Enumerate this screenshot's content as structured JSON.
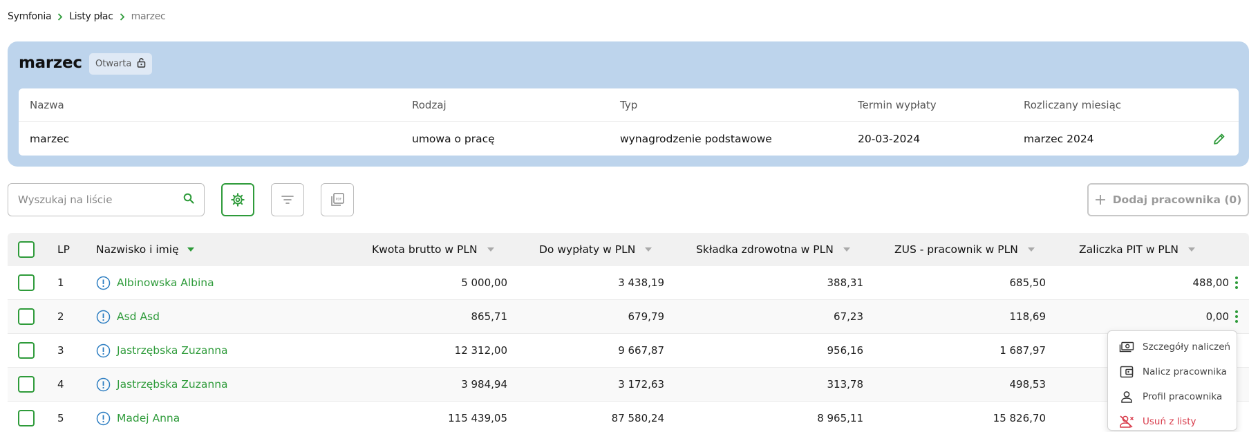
{
  "breadcrumb": [
    "Symfonia",
    "Listy płac",
    "marzec"
  ],
  "header": {
    "title": "marzec",
    "status": "Otwarta",
    "columns": [
      "Nazwa",
      "Rodzaj",
      "Typ",
      "Termin wypłaty",
      "Rozliczany miesiąc"
    ],
    "values": [
      "marzec",
      "umowa o pracę",
      "wynagrodzenie podstawowe",
      "20-03-2024",
      "marzec 2024"
    ]
  },
  "toolbar": {
    "search_placeholder": "Wyszukaj na liście",
    "add_label": "Dodaj pracownika (0)"
  },
  "table": {
    "columns": {
      "lp": "LP",
      "name": "Nazwisko i imię",
      "gross": "Kwota brutto w PLN",
      "payout": "Do wypłaty w PLN",
      "health": "Składka zdrowotna w PLN",
      "zus": "ZUS - pracownik w PLN",
      "pit": "Zaliczka PIT w PLN"
    },
    "rows": [
      {
        "lp": "1",
        "name": "Albinowska Albina",
        "gross": "5 000,00",
        "payout": "3 438,19",
        "health": "388,31",
        "zus": "685,50",
        "pit": "488,00"
      },
      {
        "lp": "2",
        "name": "Asd Asd",
        "gross": "865,71",
        "payout": "679,79",
        "health": "67,23",
        "zus": "118,69",
        "pit": "0,00"
      },
      {
        "lp": "3",
        "name": "Jastrzębska Zuzanna",
        "gross": "12 312,00",
        "payout": "9 667,87",
        "health": "956,16",
        "zus": "1 687,97",
        "pit": ""
      },
      {
        "lp": "4",
        "name": "Jastrzębska Zuzanna",
        "gross": "3 984,94",
        "payout": "3 172,63",
        "health": "313,78",
        "zus": "498,53",
        "pit": ""
      },
      {
        "lp": "5",
        "name": "Madej Anna",
        "gross": "115 439,05",
        "payout": "87 580,24",
        "health": "8 965,11",
        "zus": "15 826,70",
        "pit": ""
      }
    ]
  },
  "menu": {
    "items": [
      {
        "label": "Szczegóły naliczeń",
        "icon": "cash-icon"
      },
      {
        "label": "Nalicz pracownika",
        "icon": "wallet-icon"
      },
      {
        "label": "Profil pracownika",
        "icon": "user-icon"
      },
      {
        "label": "Usuń z listy",
        "icon": "user-remove-icon"
      }
    ]
  },
  "colors": {
    "accent": "#2e9b3a",
    "header_bg": "#bdd4ec",
    "danger": "#d83a4a"
  }
}
